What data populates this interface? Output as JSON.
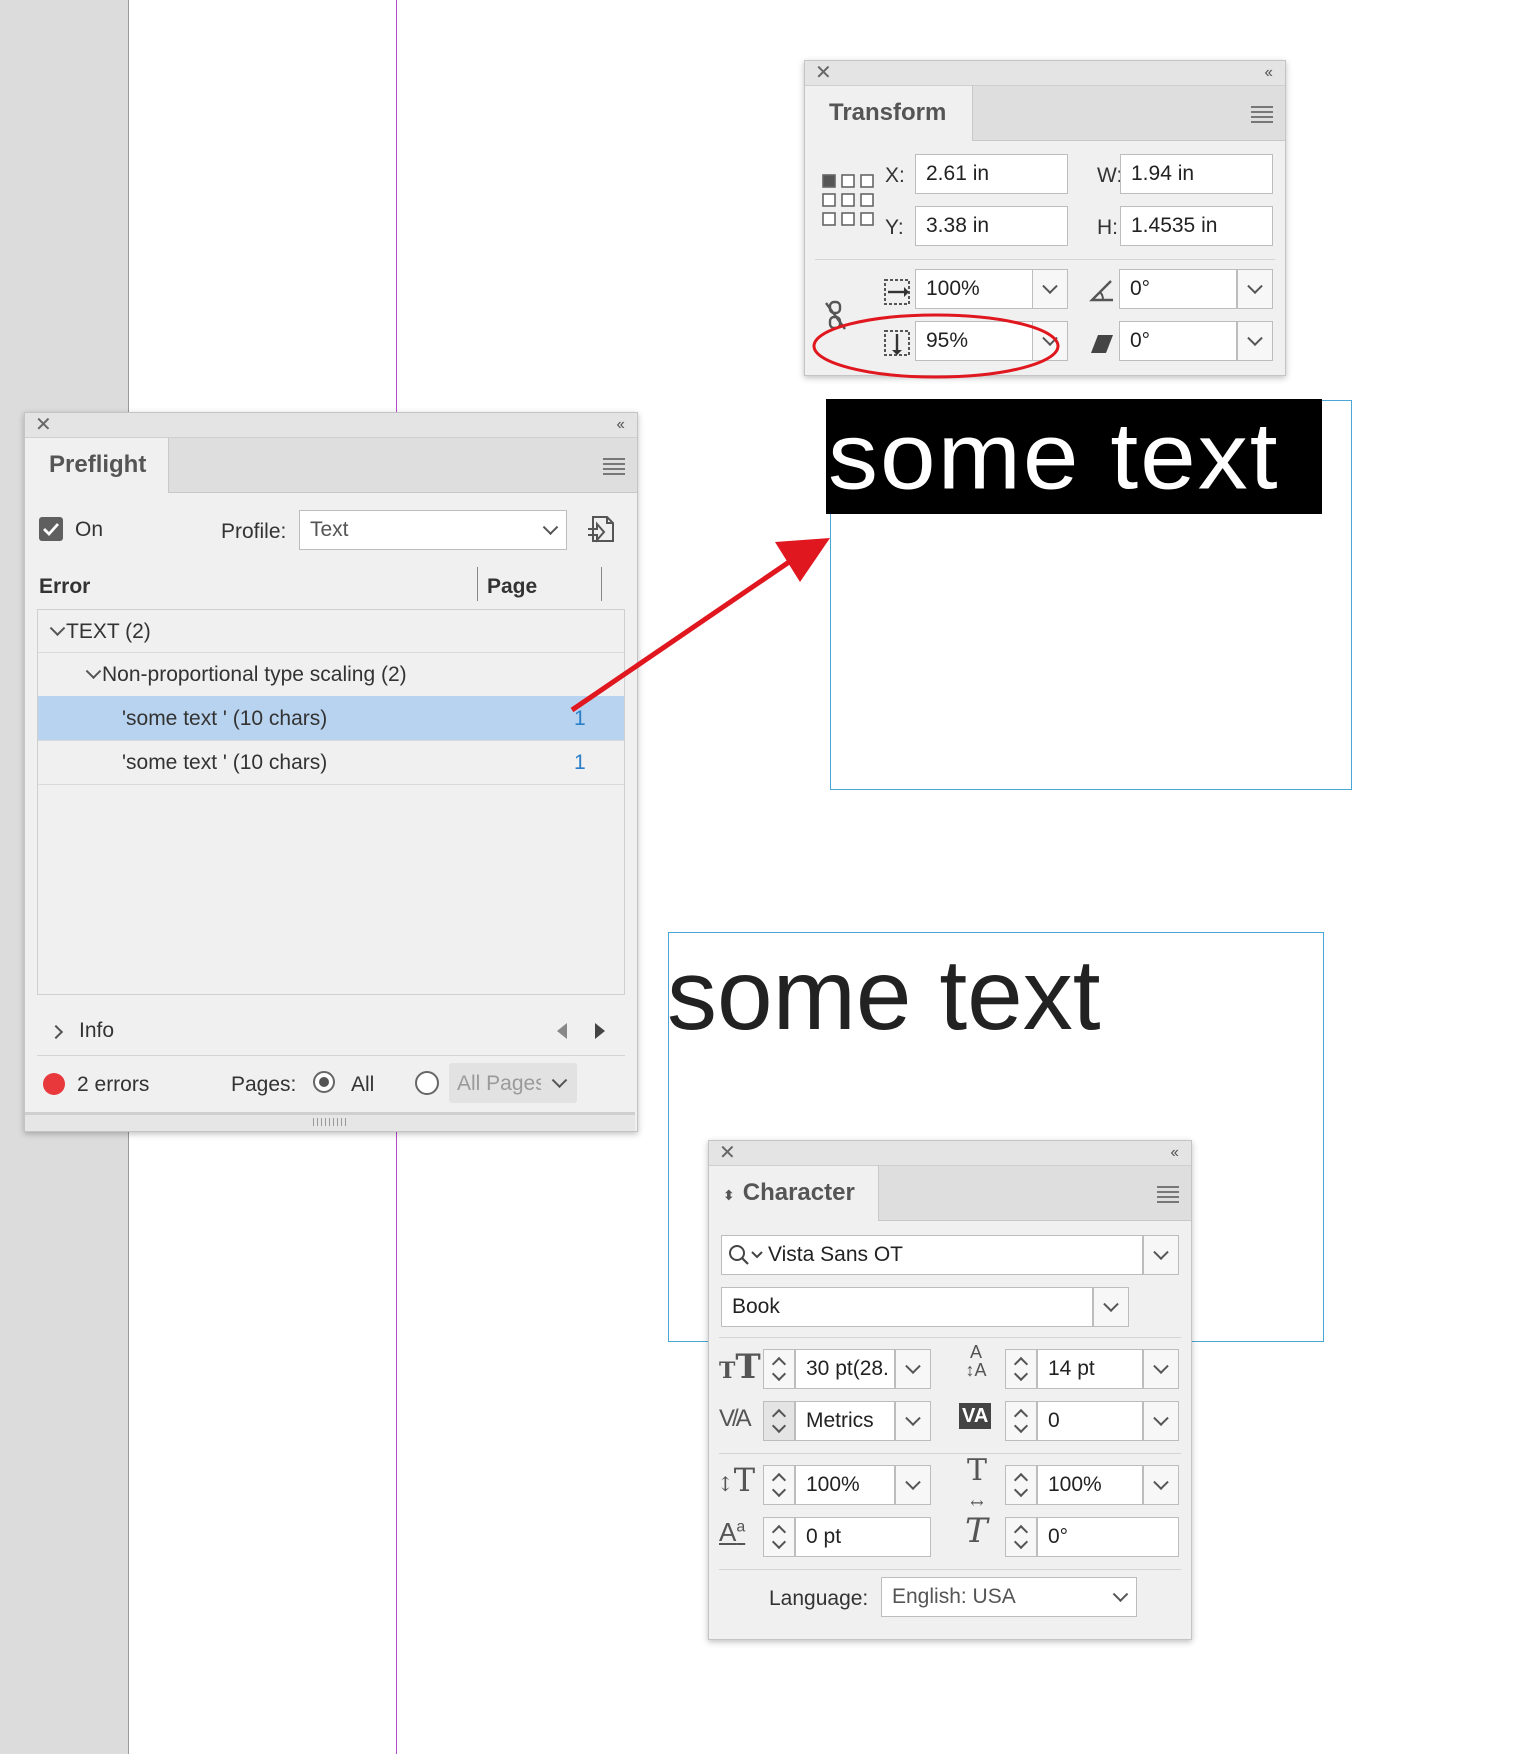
{
  "transform": {
    "title": "Transform",
    "x_label": "X:",
    "x_value": "2.61 in",
    "y_label": "Y:",
    "y_value": "3.38 in",
    "w_label": "W:",
    "w_value": "1.94 in",
    "h_label": "H:",
    "h_value": "1.4535 in",
    "scale_x": "100%",
    "scale_y": "95%",
    "rotation": "0°",
    "shear": "0°"
  },
  "canvas": {
    "text_selected": "some text",
    "text_plain": "some text"
  },
  "preflight": {
    "title": "Preflight",
    "on_label": "On",
    "on_checked": true,
    "profile_label": "Profile:",
    "profile_value": "Text",
    "col_error": "Error",
    "col_page": "Page",
    "group": "TEXT (2)",
    "subgroup": "Non-proportional type scaling (2)",
    "rows": [
      {
        "label": "'some text ' (10 chars)",
        "page": "1",
        "selected": true
      },
      {
        "label": "'some text ' (10 chars)",
        "page": "1",
        "selected": false
      }
    ],
    "info_label": "Info",
    "error_count": "2 errors",
    "pages_label": "Pages:",
    "all_label": "All",
    "all_pages_placeholder": "All Pages"
  },
  "character": {
    "title": "Character",
    "font_family": "Vista Sans OT",
    "font_style": "Book",
    "font_size": "30 pt(28.",
    "leading": "14 pt",
    "kerning": "Metrics",
    "tracking": "0",
    "vertical_scale": "100%",
    "horizontal_scale": "100%",
    "baseline_shift": "0 pt",
    "skew": "0°",
    "language_label": "Language:",
    "language_value": "English: USA"
  },
  "colors": {
    "selection_row": "#b8d3ef",
    "frame_edge": "#4aa6d4",
    "margin_guide": "#b04cc8",
    "annotation_red": "#e0171f",
    "page_link": "#2a7fc9"
  }
}
